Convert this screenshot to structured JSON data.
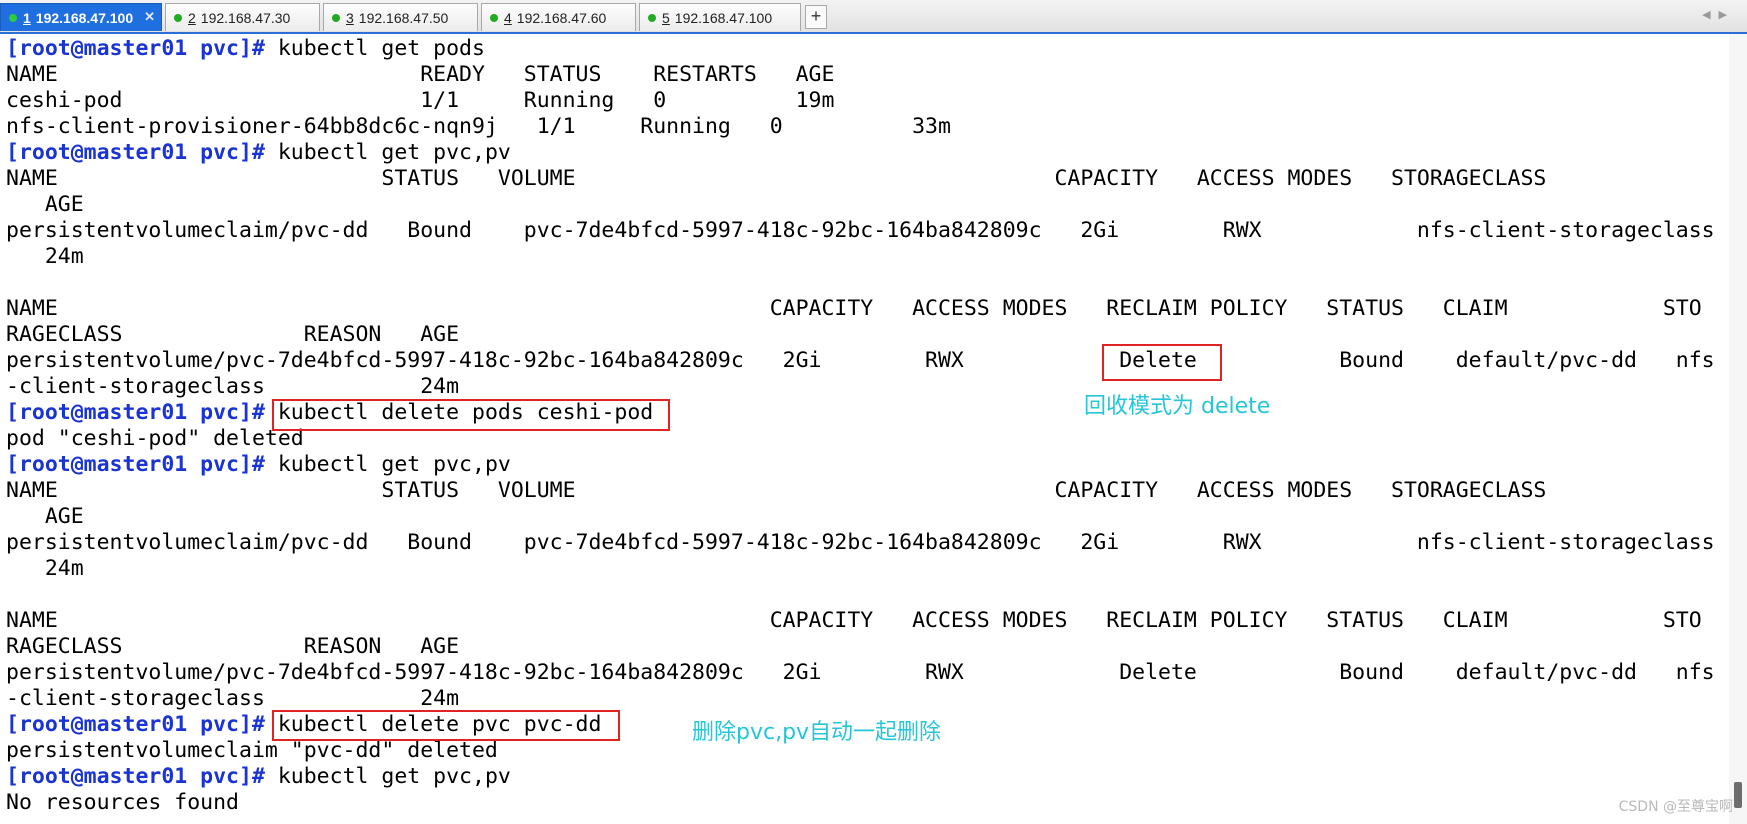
{
  "tabs": [
    {
      "num": "1",
      "host": "192.168.47.100",
      "active": true,
      "status_color": "#2ecc40"
    },
    {
      "num": "2",
      "host": "192.168.47.30",
      "active": false,
      "status_color": "#22aa22"
    },
    {
      "num": "3",
      "host": "192.168.47.50",
      "active": false,
      "status_color": "#22aa22"
    },
    {
      "num": "4",
      "host": "192.168.47.60",
      "active": false,
      "status_color": "#22aa22"
    },
    {
      "num": "5",
      "host": "192.168.47.100",
      "active": false,
      "status_color": "#22aa22"
    }
  ],
  "new_tab_label": "+",
  "close_glyph": "✕",
  "terminal": {
    "prompt": "[root@master01 pvc]#",
    "lines": [
      {
        "prompt": true,
        "text": "kubectl get pods"
      },
      {
        "text": "NAME                            READY   STATUS    RESTARTS   AGE"
      },
      {
        "text": "ceshi-pod                       1/1     Running   0          19m"
      },
      {
        "text": "nfs-client-provisioner-64bb8dc6c-nqn9j   1/1     Running   0          33m"
      },
      {
        "prompt": true,
        "text": "kubectl get pvc,pv"
      },
      {
        "text": "NAME                         STATUS   VOLUME                                     CAPACITY   ACCESS MODES   STORAGECLASS"
      },
      {
        "text": "   AGE"
      },
      {
        "text": "persistentvolumeclaim/pvc-dd   Bound    pvc-7de4bfcd-5997-418c-92bc-164ba842809c   2Gi        RWX            nfs-client-storageclass"
      },
      {
        "text": "   24m"
      },
      {
        "text": ""
      },
      {
        "text": "NAME                                                       CAPACITY   ACCESS MODES   RECLAIM POLICY   STATUS   CLAIM            STO"
      },
      {
        "text": "RAGECLASS              REASON   AGE"
      },
      {
        "text": "persistentvolume/pvc-7de4bfcd-5997-418c-92bc-164ba842809c   2Gi        RWX            Delete           Bound    default/pvc-dd   nfs"
      },
      {
        "text": "-client-storageclass            24m"
      },
      {
        "prompt": true,
        "text": "kubectl delete pods ceshi-pod"
      },
      {
        "text": "pod \"ceshi-pod\" deleted"
      },
      {
        "prompt": true,
        "text": "kubectl get pvc,pv"
      },
      {
        "text": "NAME                         STATUS   VOLUME                                     CAPACITY   ACCESS MODES   STORAGECLASS"
      },
      {
        "text": "   AGE"
      },
      {
        "text": "persistentvolumeclaim/pvc-dd   Bound    pvc-7de4bfcd-5997-418c-92bc-164ba842809c   2Gi        RWX            nfs-client-storageclass"
      },
      {
        "text": "   24m"
      },
      {
        "text": ""
      },
      {
        "text": "NAME                                                       CAPACITY   ACCESS MODES   RECLAIM POLICY   STATUS   CLAIM            STO"
      },
      {
        "text": "RAGECLASS              REASON   AGE"
      },
      {
        "text": "persistentvolume/pvc-7de4bfcd-5997-418c-92bc-164ba842809c   2Gi        RWX            Delete           Bound    default/pvc-dd   nfs"
      },
      {
        "text": "-client-storageclass            24m"
      },
      {
        "prompt": true,
        "text": "kubectl delete pvc pvc-dd"
      },
      {
        "text": "persistentvolumeclaim \"pvc-dd\" deleted"
      },
      {
        "prompt": true,
        "text": "kubectl get pvc,pv"
      },
      {
        "text": "No resources found"
      }
    ]
  },
  "annotations": {
    "reclaim_note": "回收模式为 delete",
    "delete_note": "删除pvc,pv自动一起删除"
  },
  "highlight_color": "#e02424",
  "annotation_color": "#25c6d8",
  "watermark": "CSDN @至尊宝啊"
}
